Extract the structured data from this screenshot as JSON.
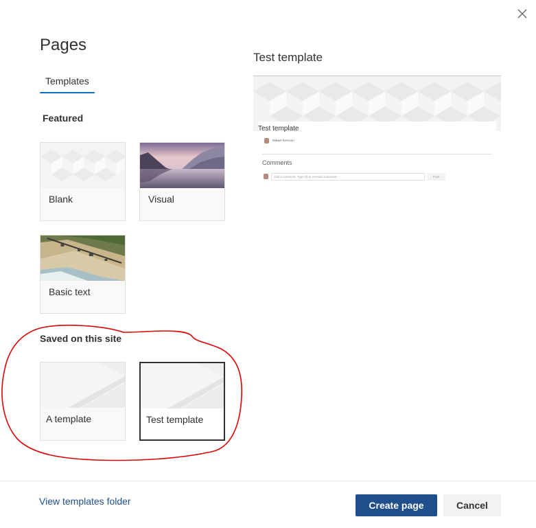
{
  "dialog": {
    "close_icon": "close-icon",
    "title": "Pages"
  },
  "tabs": [
    {
      "label": "Templates",
      "selected": true
    }
  ],
  "featured": {
    "title": "Featured",
    "templates": [
      {
        "label": "Blank",
        "thumbnail": "geometric-pattern"
      },
      {
        "label": "Visual",
        "thumbnail": "lake-mountains-photo"
      },
      {
        "label": "Basic text",
        "thumbnail": "beach-aerial-photo"
      }
    ]
  },
  "saved": {
    "title": "Saved on this site",
    "templates": [
      {
        "label": "A template",
        "thumbnail": "abstract-light",
        "selected": false
      },
      {
        "label": "Test template",
        "thumbnail": "abstract-light",
        "selected": true
      }
    ]
  },
  "preview": {
    "title": "Test template",
    "page_title": "Test template",
    "author": "Mikael Svenson",
    "comments_label": "Comments",
    "comment_placeholder": "Add a comment. Type @ to mention someone",
    "post_label": "Post"
  },
  "footer": {
    "link": "View templates folder",
    "primary_button": "Create page",
    "secondary_button": "Cancel"
  },
  "colors": {
    "accent": "#1e4e8c",
    "annotation": "#e00000",
    "tab_underline": "#0f6cbd"
  }
}
